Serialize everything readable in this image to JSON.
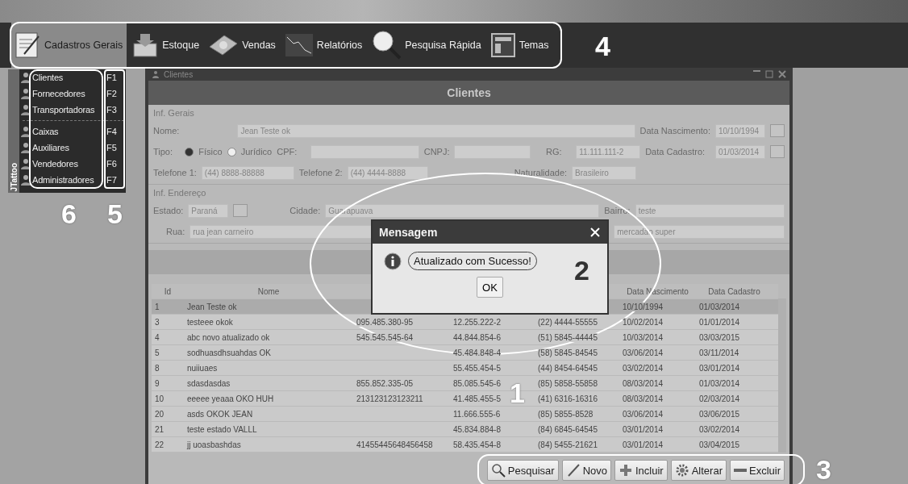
{
  "toolbar": [
    {
      "label": "Cadastros Gerais",
      "selected": true
    },
    {
      "label": "Estoque",
      "selected": false
    },
    {
      "label": "Vendas",
      "selected": false
    },
    {
      "label": "Relatórios",
      "selected": false
    },
    {
      "label": "Pesquisa Rápida",
      "selected": false
    },
    {
      "label": "Temas",
      "selected": false
    }
  ],
  "side_tab": "JTattoo",
  "menu": [
    {
      "kind": "item",
      "label": "Clientes",
      "shortcut": "F1"
    },
    {
      "kind": "item",
      "label": "Fornecedores",
      "shortcut": "F2"
    },
    {
      "kind": "item",
      "label": "Transportadoras",
      "shortcut": "F3"
    },
    {
      "kind": "separator"
    },
    {
      "kind": "item",
      "label": "Caixas",
      "shortcut": "F4"
    },
    {
      "kind": "item",
      "label": "Auxiliares",
      "shortcut": "F5"
    },
    {
      "kind": "item",
      "label": "Vendedores",
      "shortcut": "F6"
    },
    {
      "kind": "item",
      "label": "Administradores",
      "shortcut": "F7"
    }
  ],
  "window": {
    "title": "Clientes",
    "header": "Clientes"
  },
  "general": {
    "title": "Inf. Gerais",
    "nome": {
      "label": "Nome:",
      "value": "Jean Teste ok"
    },
    "data_nascimento": {
      "label": "Data Nascimento:",
      "value": "10/10/1994"
    },
    "tipo": {
      "label": "Tipo:",
      "options": [
        {
          "label": "Físico",
          "selected": true
        },
        {
          "label": "Jurídico",
          "selected": false
        }
      ]
    },
    "cpf": {
      "label": "CPF:"
    },
    "cnpj": {
      "label": "CNPJ:"
    },
    "rg": {
      "label": "RG:",
      "value": "11.111.111-2"
    },
    "data_cadastro": {
      "label": "Data Cadastro:",
      "value": "01/03/2014"
    },
    "telefone_1": {
      "label": "Telefone 1:",
      "value": "(44) 8888-88888"
    },
    "telefone_2": {
      "label": "Telefone 2:",
      "value": "(44) 4444-8888"
    },
    "naturalidade": {
      "label": "Naturalidade:",
      "value": "Brasileiro"
    }
  },
  "address": {
    "title": "Inf. Endereço",
    "estado": {
      "label": "Estado:",
      "value": "Paraná"
    },
    "cidade": {
      "label": "Cidade:",
      "value": "Guarapuava"
    },
    "bairro": {
      "label": "Bairro:",
      "value": "teste"
    },
    "rua": {
      "label": "Rua:",
      "value": "rua jean carneiro"
    },
    "field_6": {
      "value": "mercadão super"
    }
  },
  "table": {
    "columns": [
      "Id",
      "Nome",
      null,
      null,
      null,
      "Data Nascimento",
      "Data Cadastro"
    ],
    "rows": [
      {
        "selected": true,
        "cells": [
          "1",
          "Jean Teste ok",
          null,
          null,
          null,
          "10/10/1994",
          "01/03/2014"
        ]
      },
      {
        "selected": false,
        "cells": [
          "3",
          "testeee okok",
          "095.485.380-95",
          "12.255.222-2",
          "(22) 4444-55555",
          "10/02/2014",
          "01/01/2014"
        ]
      },
      {
        "selected": false,
        "cells": [
          "4",
          "abc novo atualizado ok",
          "545.545.545-64",
          "44.844.854-6",
          "(51) 5845-44445",
          "10/03/2014",
          "03/03/2015"
        ]
      },
      {
        "selected": false,
        "cells": [
          "5",
          "sodhuasdhsuahdas OK",
          null,
          "45.484.848-4",
          "(58) 5845-84545",
          "03/06/2014",
          "03/11/2014"
        ]
      },
      {
        "selected": false,
        "cells": [
          "8",
          "nuiiuaes",
          null,
          "55.455.454-5",
          "(44) 8454-64545",
          "03/02/2014",
          "03/01/2014"
        ]
      },
      {
        "selected": false,
        "cells": [
          "9",
          "sdasdasdas",
          "855.852.335-05",
          "85.085.545-6",
          "(85) 5858-55858",
          "08/03/2014",
          "01/03/2014"
        ]
      },
      {
        "selected": false,
        "cells": [
          "10",
          "eeeee yeaaa OKO HUH",
          "213123123123211",
          "41.485.455-5",
          "(41) 6316-16316",
          "08/03/2014",
          "02/03/2014"
        ]
      },
      {
        "selected": false,
        "cells": [
          "20",
          "asds OKOK JEAN",
          null,
          "11.666.555-6",
          "(85) 5855-8528",
          "03/06/2014",
          "03/06/2015"
        ]
      },
      {
        "selected": false,
        "cells": [
          "21",
          "teste estado VALLL",
          null,
          "45.834.884-8",
          "(84) 6845-64545",
          "03/01/2014",
          "03/02/2014"
        ]
      },
      {
        "selected": false,
        "cells": [
          "22",
          "jj uoasbashdas",
          "41455445648456458",
          "58.435.454-8",
          "(84) 5455-21621",
          "03/01/2014",
          "03/04/2015"
        ]
      }
    ]
  },
  "buttons": [
    "Pesquisar",
    "Novo",
    "Incluir",
    "Alterar",
    "Excluir"
  ],
  "dialog": {
    "title": "Mensagem",
    "message": "Atualizado com Sucesso!",
    "ok": "OK"
  },
  "callouts": [
    "1",
    "2",
    "3",
    "4",
    "5",
    "6"
  ]
}
